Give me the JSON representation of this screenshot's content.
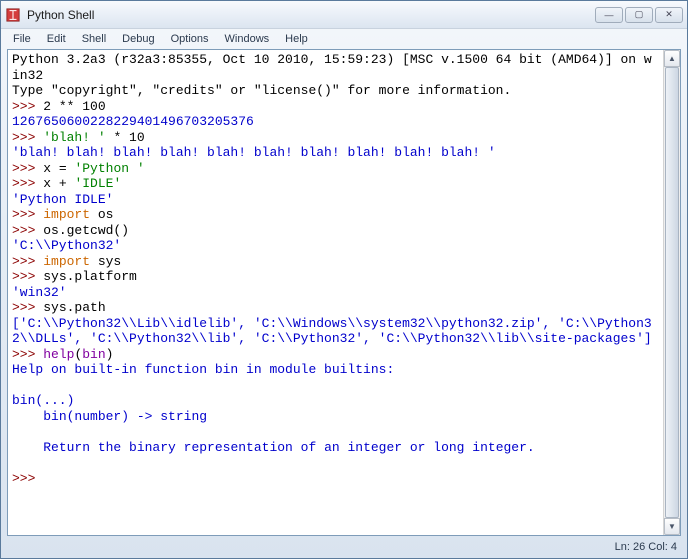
{
  "window": {
    "title": "Python Shell",
    "controls": {
      "min": "—",
      "max": "▢",
      "close": "✕"
    }
  },
  "menu": {
    "file": "File",
    "edit": "Edit",
    "shell": "Shell",
    "debug": "Debug",
    "options": "Options",
    "windows": "Windows",
    "help": "Help"
  },
  "content": {
    "line1": "Python 3.2a3 (r32a3:85355, Oct 10 2010, 15:59:23) [MSC v.1500 64 bit (AMD64)] on win32",
    "line2": "Type \"copyright\", \"credits\" or \"license()\" for more information.",
    "prompt": ">>> ",
    "cmd1": "2 ** 100",
    "out1": "1267650600228229401496703205376",
    "cmd2a": "'blah! '",
    "cmd2b": " * 10",
    "out2": "'blah! blah! blah! blah! blah! blah! blah! blah! blah! blah! '",
    "cmd3a": "x = ",
    "cmd3b": "'Python '",
    "cmd4a": "x + ",
    "cmd4b": "'IDLE'",
    "out4": "'Python IDLE'",
    "cmd5a": "import",
    "cmd5b": " os",
    "cmd6": "os.getcwd()",
    "out6": "'C:\\\\Python32'",
    "cmd7a": "import",
    "cmd7b": " sys",
    "cmd8": "sys.platform",
    "out8": "'win32'",
    "cmd9": "sys.path",
    "out9": "['C:\\\\Python32\\\\Lib\\\\idlelib', 'C:\\\\Windows\\\\system32\\\\python32.zip', 'C:\\\\Python32\\\\DLLs', 'C:\\\\Python32\\\\lib', 'C:\\\\Python32', 'C:\\\\Python32\\\\lib\\\\site-packages']",
    "cmd10a": "help",
    "cmd10b": "(",
    "cmd10c": "bin",
    "cmd10d": ")",
    "out10a": "Help on built-in function bin in module builtins:",
    "out10b": "bin(...)",
    "out10c": "    bin(number) -> string",
    "out10d": "    Return the binary representation of an integer or long integer.",
    "blank": ""
  },
  "status": {
    "pos": "Ln: 26 Col: 4"
  }
}
